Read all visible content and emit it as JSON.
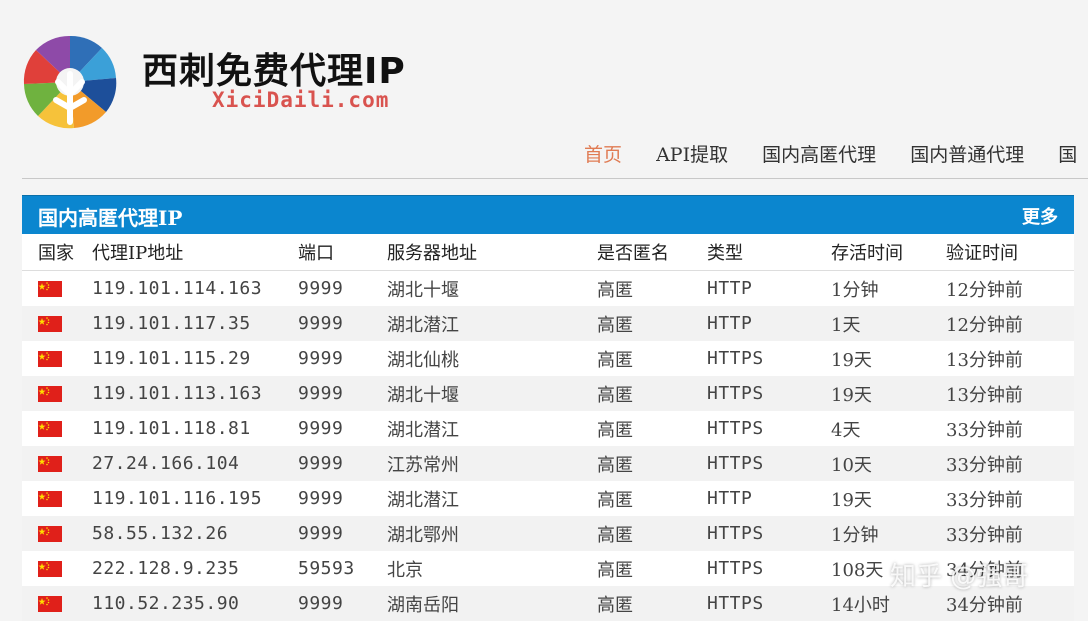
{
  "site": {
    "title": "西刺免费代理IP",
    "domain": "XiciDaili.com"
  },
  "nav": {
    "items": [
      {
        "label": "首页",
        "active": true
      },
      {
        "label": "API提取",
        "active": false
      },
      {
        "label": "国内高匿代理",
        "active": false
      },
      {
        "label": "国内普通代理",
        "active": false
      },
      {
        "label": "国",
        "active": false
      }
    ]
  },
  "panel": {
    "title": "国内高匿代理IP",
    "more": "更多"
  },
  "table": {
    "headers": [
      "国家",
      "代理IP地址",
      "端口",
      "服务器地址",
      "是否匿名",
      "类型",
      "存活时间",
      "验证时间"
    ],
    "rows": [
      {
        "flag": "cn-flag",
        "ip": "119.101.114.163",
        "port": "9999",
        "location": "湖北十堰",
        "anon": "高匿",
        "type": "HTTP",
        "alive": "1分钟",
        "verified": "12分钟前"
      },
      {
        "flag": "cn-flag",
        "ip": "119.101.117.35",
        "port": "9999",
        "location": "湖北潜江",
        "anon": "高匿",
        "type": "HTTP",
        "alive": "1天",
        "verified": "12分钟前"
      },
      {
        "flag": "cn-flag",
        "ip": "119.101.115.29",
        "port": "9999",
        "location": "湖北仙桃",
        "anon": "高匿",
        "type": "HTTPS",
        "alive": "19天",
        "verified": "13分钟前"
      },
      {
        "flag": "cn-flag",
        "ip": "119.101.113.163",
        "port": "9999",
        "location": "湖北十堰",
        "anon": "高匿",
        "type": "HTTPS",
        "alive": "19天",
        "verified": "13分钟前"
      },
      {
        "flag": "cn-flag",
        "ip": "119.101.118.81",
        "port": "9999",
        "location": "湖北潜江",
        "anon": "高匿",
        "type": "HTTPS",
        "alive": "4天",
        "verified": "33分钟前"
      },
      {
        "flag": "cn-flag",
        "ip": "27.24.166.104",
        "port": "9999",
        "location": "江苏常州",
        "anon": "高匿",
        "type": "HTTPS",
        "alive": "10天",
        "verified": "33分钟前"
      },
      {
        "flag": "cn-flag",
        "ip": "119.101.116.195",
        "port": "9999",
        "location": "湖北潜江",
        "anon": "高匿",
        "type": "HTTP",
        "alive": "19天",
        "verified": "33分钟前"
      },
      {
        "flag": "cn-flag",
        "ip": "58.55.132.26",
        "port": "9999",
        "location": "湖北鄂州",
        "anon": "高匿",
        "type": "HTTPS",
        "alive": "1分钟",
        "verified": "33分钟前"
      },
      {
        "flag": "cn-flag",
        "ip": "222.128.9.235",
        "port": "59593",
        "location": "北京",
        "anon": "高匿",
        "type": "HTTPS",
        "alive": "108天",
        "verified": "34分钟前"
      },
      {
        "flag": "cn-flag",
        "ip": "110.52.235.90",
        "port": "9999",
        "location": "湖南岳阳",
        "anon": "高匿",
        "type": "HTTPS",
        "alive": "14小时",
        "verified": "34分钟前"
      }
    ]
  },
  "watermark": "知乎 @强哥",
  "colors": {
    "panel_header": "#0b86cf",
    "nav_active": "#e07b53",
    "domain_text": "#d9534f",
    "flag_red": "#e0201a",
    "flag_star": "#ffde00"
  }
}
